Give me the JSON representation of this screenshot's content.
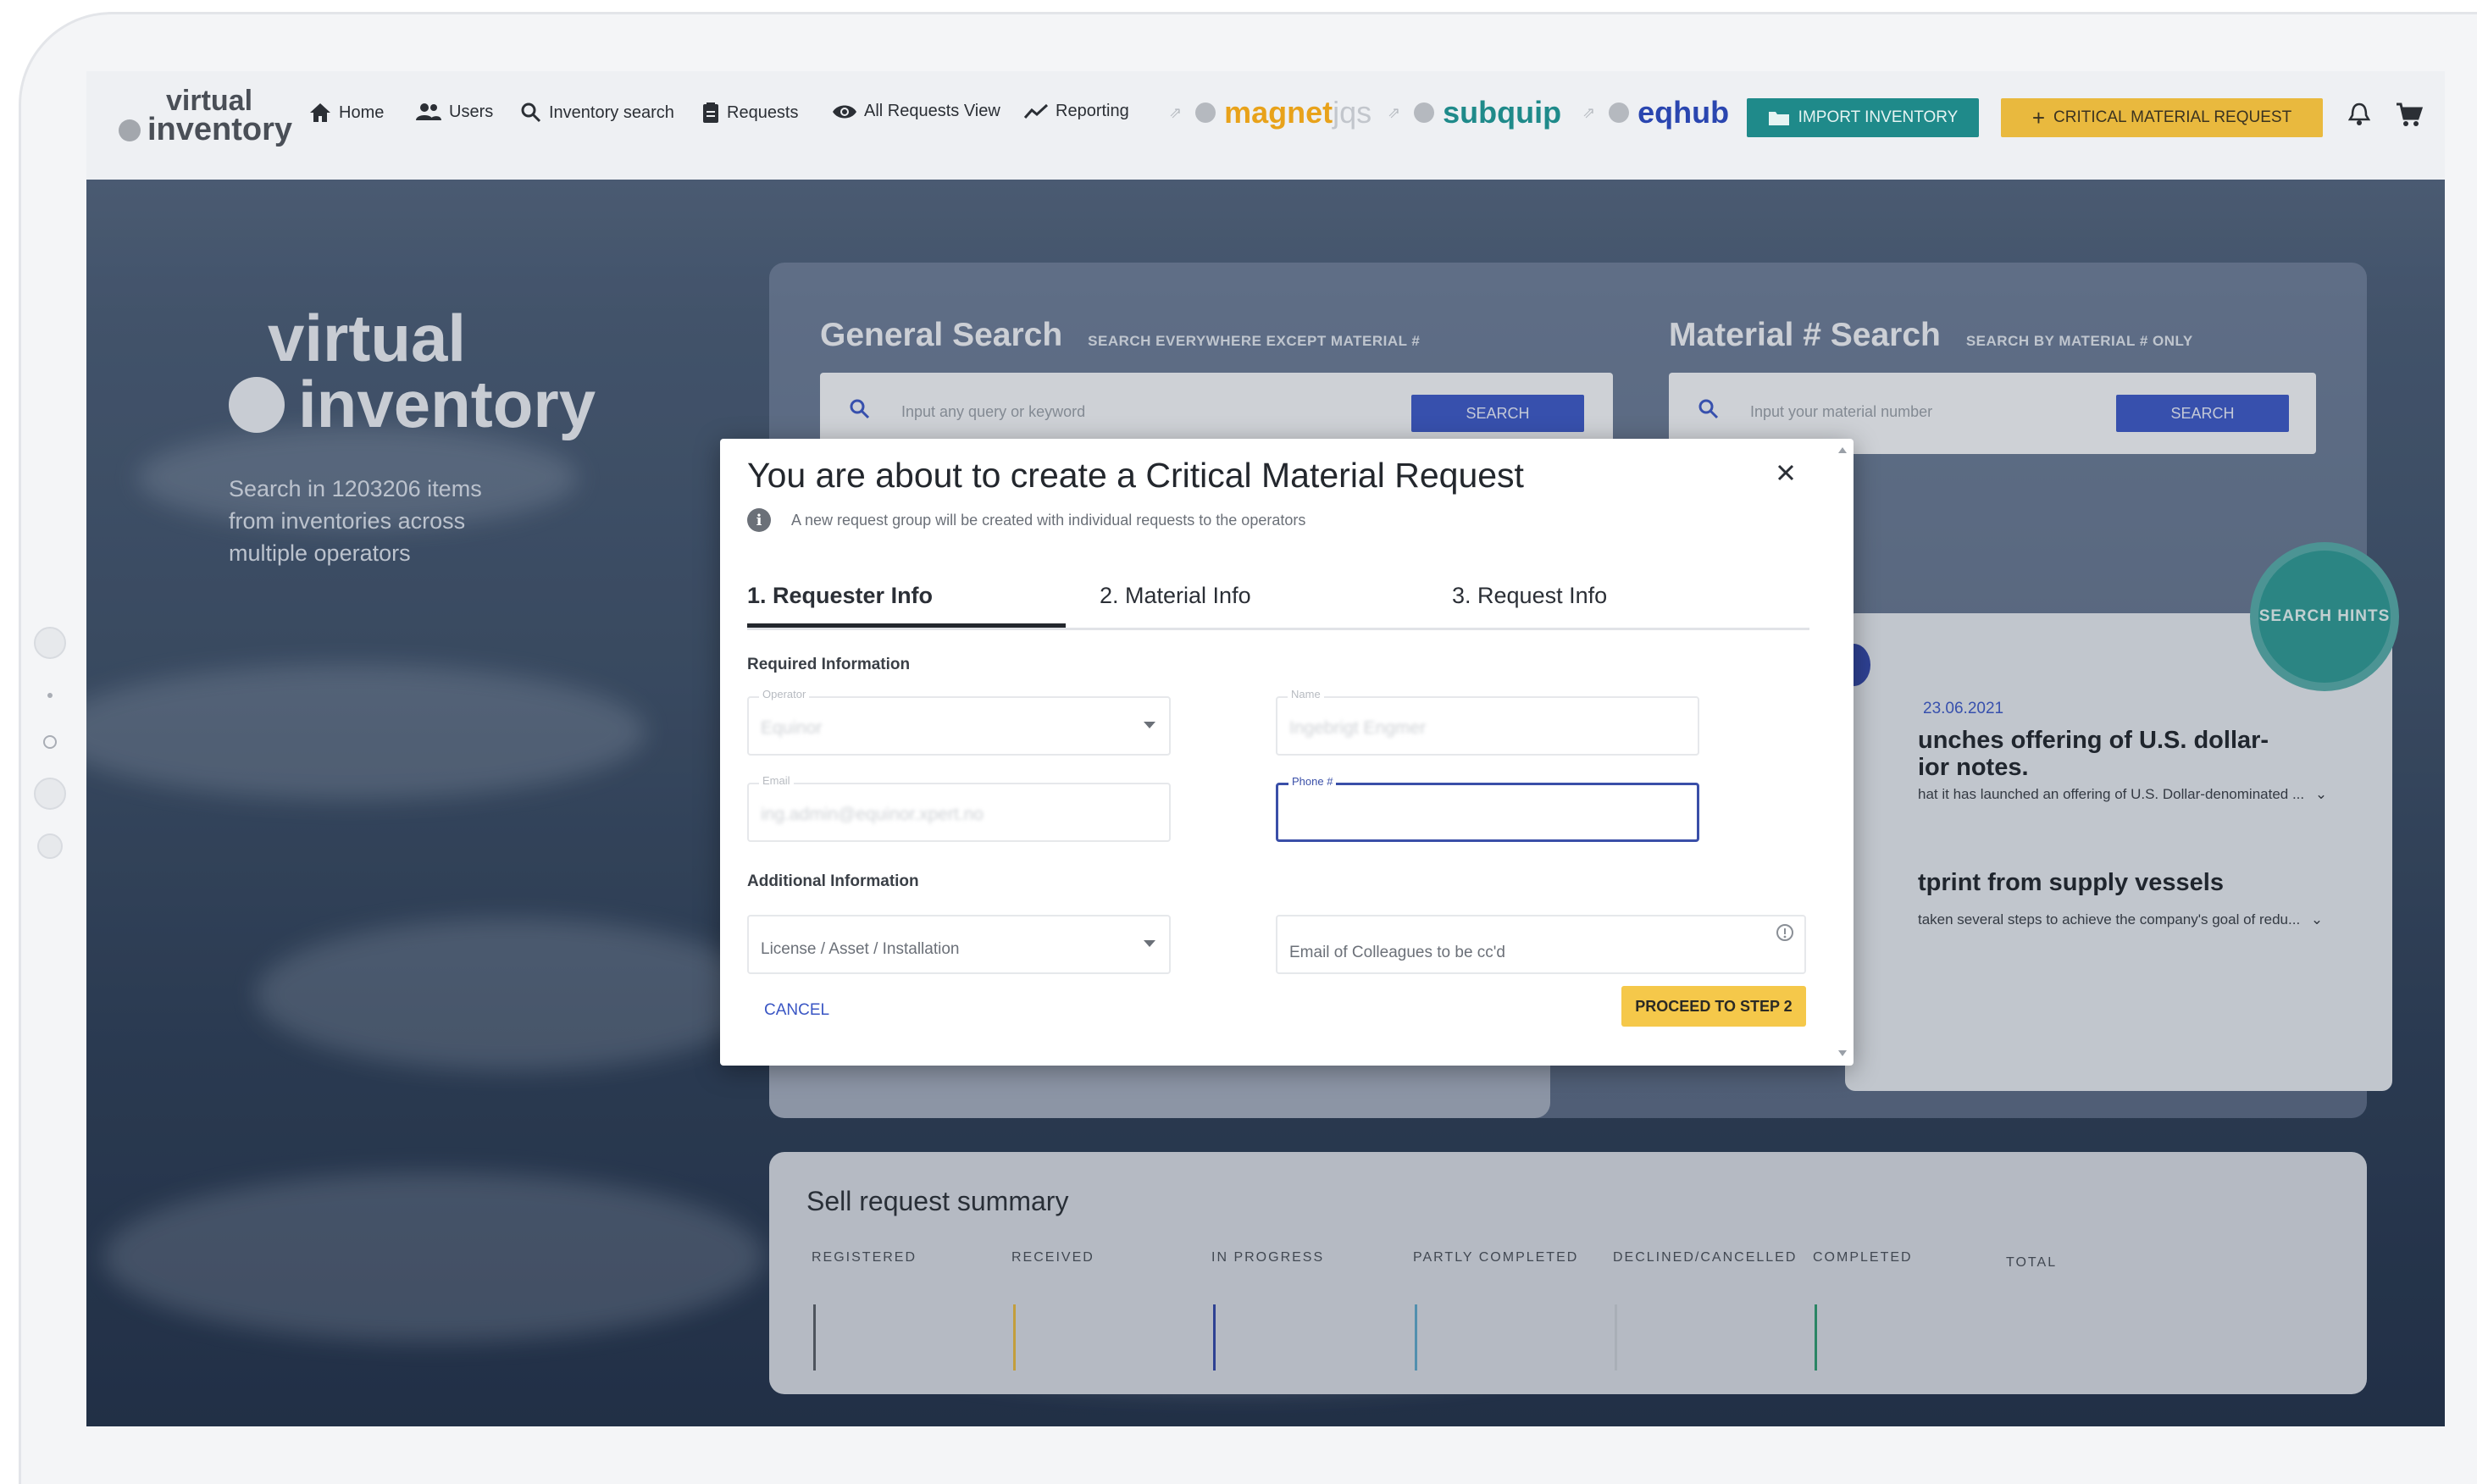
{
  "app": {
    "logo_line1": "virtual",
    "logo_line2": "inventory"
  },
  "nav": {
    "items": [
      {
        "label": "Home",
        "icon": "home-icon"
      },
      {
        "label": "Users",
        "icon": "users-icon"
      },
      {
        "label": "Inventory search",
        "icon": "search-icon"
      },
      {
        "label": "Requests",
        "icon": "clipboard-icon"
      },
      {
        "label": "All Requests View",
        "icon": "eye-icon"
      },
      {
        "label": "Reporting",
        "icon": "trend-icon"
      }
    ],
    "brands": [
      {
        "name_a": "magnet",
        "name_b": "jqs",
        "color_a": "#e8a21a",
        "color_b": "#c9ccd1"
      },
      {
        "name_a": "subquip",
        "name_b": "",
        "color_a": "#1f8a8a",
        "color_b": "#1f8a8a"
      },
      {
        "name_a": "eqhub",
        "name_b": "",
        "color_a": "#2a46b0",
        "color_b": "#2a46b0"
      }
    ],
    "import_label": "IMPORT INVENTORY",
    "critical_label": "CRITICAL MATERIAL REQUEST",
    "critical_prefix": "+"
  },
  "hero": {
    "title1": "virtual",
    "title2": "inventory",
    "subtitle": "Search in 1203206 items from inventories across multiple operators"
  },
  "general_search": {
    "title": "General Search",
    "hint": "SEARCH EVERYWHERE EXCEPT MATERIAL #",
    "placeholder": "Input any query or keyword",
    "button": "SEARCH"
  },
  "material_search": {
    "title": "Material # Search",
    "hint": "SEARCH BY MATERIAL # ONLY",
    "placeholder": "Input your material number",
    "button": "SEARCH"
  },
  "search_hints": "SEARCH HINTS",
  "news": {
    "date": "23.06.2021",
    "item1_title": "unches offering of U.S. dollar-ior notes.",
    "item1_title_a": "unches offering of U.S. dollar-",
    "item1_title_b": "ior notes.",
    "item1_text": "hat it has launched an offering of U.S. Dollar-denominated ...",
    "item2_title": "tprint from supply vessels",
    "item2_text": "taken several steps to achieve the company's goal of redu..."
  },
  "summary": {
    "title": "Sell request summary",
    "columns": [
      {
        "label": "REGISTERED",
        "color": "#5a5f66"
      },
      {
        "label": "RECEIVED",
        "color": "#e8b93e"
      },
      {
        "label": "IN PROGRESS",
        "color": "#3347a8"
      },
      {
        "label": "PARTLY COMPLETED",
        "color": "#5fa6c9"
      },
      {
        "label": "DECLINED/CANCELLED",
        "color": ""
      },
      {
        "label": "COMPLETED",
        "color": "#2f9a6e"
      },
      {
        "label": "TOTAL",
        "color": ""
      }
    ]
  },
  "modal": {
    "title": "You are about to create a Critical Material Request",
    "note": "A new request group will be created with individual requests to the operators",
    "tabs": [
      "1. Requester Info",
      "2. Material Info",
      "3. Request Info"
    ],
    "required_label": "Required Information",
    "additional_label": "Additional Information",
    "fields": {
      "operator_label": "Operator",
      "operator_value": "Equinor",
      "name_label": "Name",
      "name_value": "Ingebrigt Engmer",
      "email_label": "Email",
      "email_value": "ing.admin@equinor.xpert.no",
      "phone_label": "Phone #",
      "phone_value": "",
      "license_placeholder": "License / Asset / Installation",
      "cc_placeholder": "Email of Colleagues to be cc'd"
    },
    "cancel_label": "CANCEL",
    "proceed_label": "PROCEED TO STEP 2"
  }
}
